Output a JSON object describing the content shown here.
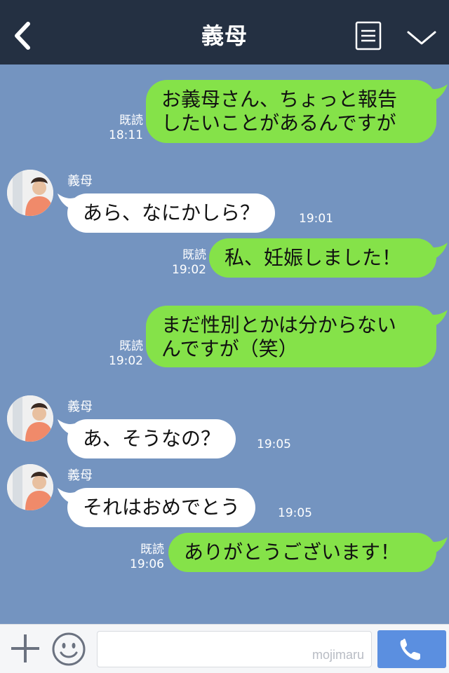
{
  "header": {
    "title": "義母",
    "back_icon": "back-chevron-icon",
    "menu_icon": "menu-lines-icon",
    "collapse_icon": "chevron-down-icon",
    "background": "#243042"
  },
  "messages": [
    {
      "side": "sent",
      "lines": [
        "お義母さん、ちょっと報告",
        "したいことがあるんですが"
      ],
      "read": "既読",
      "time": "18:11"
    },
    {
      "side": "recv",
      "sender": "義母",
      "text": "あら、なにかしら？",
      "time": "19:01"
    },
    {
      "side": "sent",
      "lines": [
        "私、妊娠しました！"
      ],
      "read": "既読",
      "time": "19:02"
    },
    {
      "side": "sent",
      "lines": [
        "まだ性別とかは分からない",
        "んですが（笑）"
      ],
      "read": "既読",
      "time": "19:02"
    },
    {
      "side": "recv",
      "sender": "義母",
      "text": "あ、そうなの？",
      "time": "19:05"
    },
    {
      "side": "recv",
      "sender": "義母",
      "text": "それはおめでとう",
      "time": "19:05"
    },
    {
      "side": "sent",
      "lines": [
        "ありがとうございます！"
      ],
      "read": "既読",
      "time": "19:06"
    }
  ],
  "footer": {
    "plus_icon": "plus-icon",
    "sticker_icon": "smiley-icon",
    "input_value": "",
    "watermark": "mojimaru",
    "call_icon": "phone-icon"
  },
  "colors": {
    "chat_background": "#7494c0",
    "sent_bubble": "#85e249",
    "received_bubble": "#ffffff",
    "call_button": "#5b8fe0"
  }
}
